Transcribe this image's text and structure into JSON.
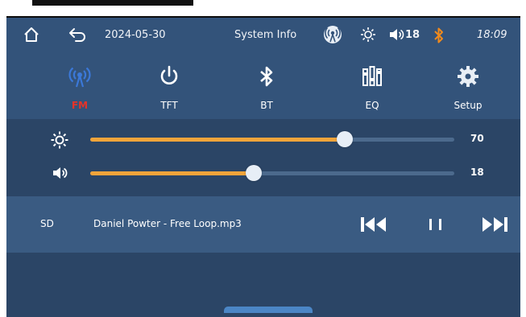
{
  "status_bar": {
    "date": "2024-05-30",
    "title": "System Info",
    "volume": "18",
    "time": "18:09"
  },
  "tabs": [
    {
      "label": "FM",
      "icon": "radio-signal-icon",
      "active": true
    },
    {
      "label": "TFT",
      "icon": "power-icon",
      "active": false
    },
    {
      "label": "BT",
      "icon": "bluetooth-icon",
      "active": false
    },
    {
      "label": "EQ",
      "icon": "equalizer-icon",
      "active": false
    },
    {
      "label": "Setup",
      "icon": "gear-icon",
      "active": false
    }
  ],
  "sliders": {
    "brightness": {
      "value": "70",
      "max": 100
    },
    "volume": {
      "value": "18",
      "max": 40
    }
  },
  "player": {
    "source": "SD",
    "track": "Daniel Powter - Free Loop.mp3"
  },
  "colors": {
    "accent": "#f2a43a",
    "active_tab": "#e53329",
    "background": "#2b4566",
    "bluetooth": "#f08a1c"
  }
}
